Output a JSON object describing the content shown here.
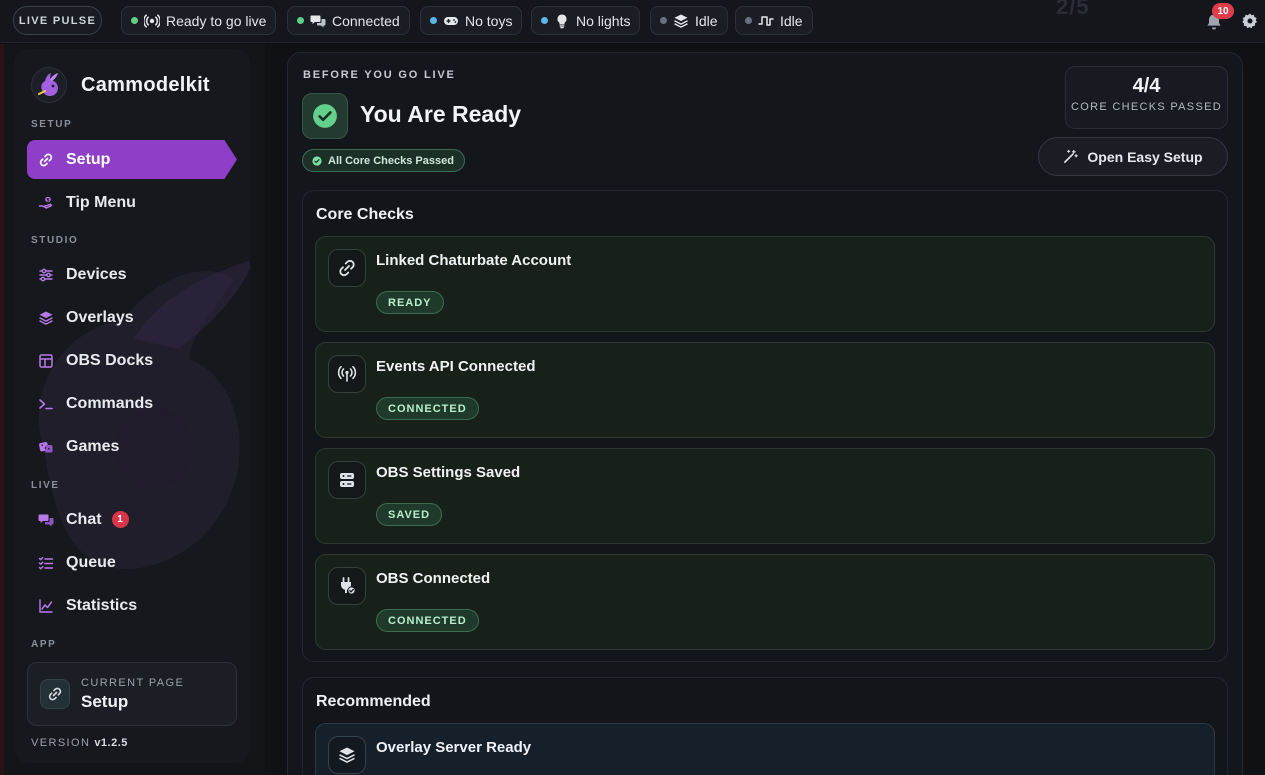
{
  "topbar": {
    "live_pulse": "LIVE PULSE",
    "ghost_counter": "2/5",
    "pills": [
      {
        "label": "Ready to go live",
        "status": "green",
        "icon": "broadcast-icon"
      },
      {
        "label": "Connected",
        "status": "green",
        "icon": "chat-bubbles-icon"
      },
      {
        "label": "No toys",
        "status": "blue",
        "icon": "gamepad-icon"
      },
      {
        "label": "No lights",
        "status": "blue",
        "icon": "lightbulb-icon"
      },
      {
        "label": "Idle",
        "status": "grey",
        "icon": "layers-icon"
      },
      {
        "label": "Idle",
        "status": "grey",
        "icon": "pulse-wave-icon"
      }
    ],
    "notifications_count": "10"
  },
  "sidebar": {
    "brand": "Cammodelkit",
    "sections": [
      "SETUP",
      "STUDIO",
      "LIVE",
      "APP"
    ],
    "items": [
      {
        "label": "Setup",
        "icon": "link-icon",
        "active": true
      },
      {
        "label": "Tip Menu",
        "icon": "hand-coin-icon"
      },
      {
        "label": "Devices",
        "icon": "sliders-icon"
      },
      {
        "label": "Overlays",
        "icon": "layers-icon"
      },
      {
        "label": "OBS Docks",
        "icon": "layout-icon"
      },
      {
        "label": "Commands",
        "icon": "terminal-icon"
      },
      {
        "label": "Games",
        "icon": "dice-icon"
      },
      {
        "label": "Chat",
        "icon": "chat-icon",
        "badge": "1"
      },
      {
        "label": "Queue",
        "icon": "list-check-icon"
      },
      {
        "label": "Statistics",
        "icon": "line-chart-icon"
      }
    ],
    "current_page_label": "CURRENT PAGE",
    "current_page_value": "Setup",
    "version_label": "VERSION",
    "version_value": "v1.2.5"
  },
  "main": {
    "eyebrow": "BEFORE YOU GO LIVE",
    "title": "You Are Ready",
    "badge": "All Core Checks Passed",
    "score_value": "4/4",
    "score_label": "CORE CHECKS PASSED",
    "easy_setup_button": "Open Easy Setup",
    "core_checks_title": "Core Checks",
    "core_checks": [
      {
        "title": "Linked Chaturbate Account",
        "status": "READY",
        "icon": "link-icon"
      },
      {
        "title": "Events API Connected",
        "status": "CONNECTED",
        "icon": "antenna-icon"
      },
      {
        "title": "OBS Settings Saved",
        "status": "SAVED",
        "icon": "server-icon"
      },
      {
        "title": "OBS Connected",
        "status": "CONNECTED",
        "icon": "plug-check-icon"
      }
    ],
    "recommended_title": "Recommended",
    "recommended": [
      {
        "title": "Overlay Server Ready",
        "icon": "layers-icon"
      }
    ]
  },
  "colors": {
    "accent": "#8f3ec8",
    "ready_green": "#5fcf86",
    "info_blue": "#58b8ea",
    "idle_grey": "#6b7080",
    "badge_red": "#e23b4b"
  }
}
